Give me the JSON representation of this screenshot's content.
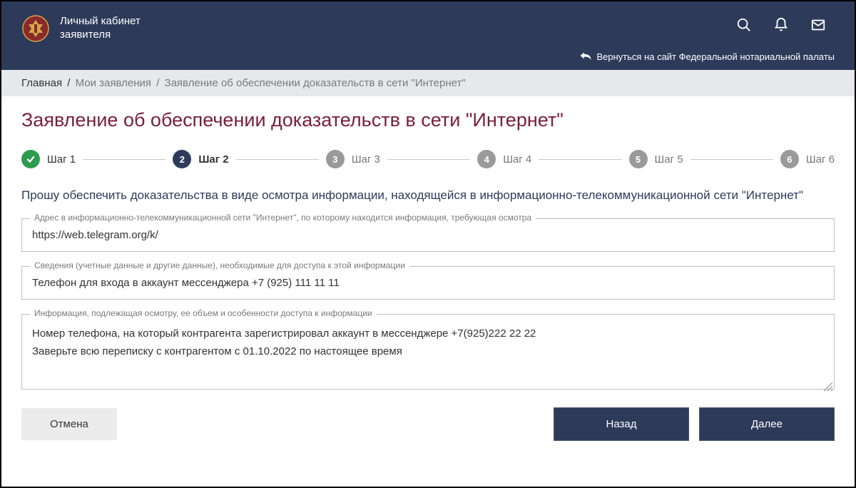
{
  "header": {
    "brand_line1": "Личный кабинет",
    "brand_line2": "заявителя",
    "back_link": "Вернуться на сайт Федеральной нотариальной палаты"
  },
  "breadcrumbs": {
    "home": "Главная",
    "my_apps": "Мои заявления",
    "current": "Заявление об обеспечении доказательств в сети \"Интернет\""
  },
  "page_title": "Заявление об обеспечении доказательств в сети \"Интернет\"",
  "steps": [
    {
      "num": "✓",
      "label": "Шаг 1"
    },
    {
      "num": "2",
      "label": "Шаг 2"
    },
    {
      "num": "3",
      "label": "Шаг 3"
    },
    {
      "num": "4",
      "label": "Шаг 4"
    },
    {
      "num": "5",
      "label": "Шаг 5"
    },
    {
      "num": "6",
      "label": "Шаг 6"
    }
  ],
  "subtitle": "Прошу обеспечить доказательства в виде осмотра информации, находящейся в информационно-телекоммуникационной сети \"Интернет\"",
  "fields": {
    "address": {
      "label": "Адрес в информационно-телекоммуникационной сети \"Интернет\", по которому находится информация, требующая осмотра",
      "value": "https://web.telegram.org/k/"
    },
    "credentials": {
      "label": "Сведения (учетные данные и другие данные), необходимые для доступа к этой информации",
      "value": "Телефон для входа в аккаунт мессенджера +7 (925) 111 11 11"
    },
    "info": {
      "label": "Информация, подлежащая осмотру, ее объем и особенности доступа к информации",
      "value": "Номер телефона, на который контрагента зарегистрировал аккаунт в мессенджере +7(925)222 22 22\nЗаверьте всю переписку с контрагентом с 01.10.2022 по настоящее время"
    }
  },
  "buttons": {
    "cancel": "Отмена",
    "back": "Назад",
    "next": "Далее"
  }
}
